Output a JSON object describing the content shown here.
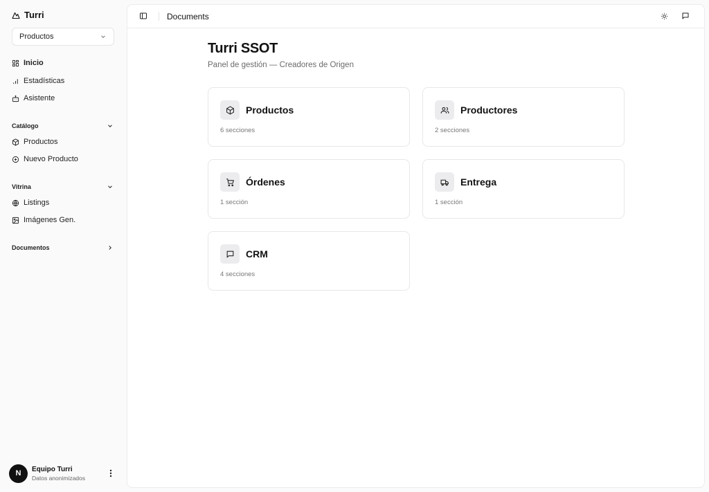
{
  "brand": {
    "name": "Turri"
  },
  "switcher": {
    "value": "Productos"
  },
  "nav": {
    "inicio": "Inicio",
    "estadisticas": "Estadísticas",
    "asistente": "Asistente"
  },
  "catalogo": {
    "label": "Catálogo",
    "productos": "Productos",
    "nuevo": "Nuevo Producto"
  },
  "vitrina": {
    "label": "Vitrina",
    "listings": "Listings",
    "imagenes": "Imágenes Gen."
  },
  "documentos": {
    "label": "Documentos"
  },
  "user": {
    "initial": "N",
    "name": "Equipo Turri",
    "sub": "Datos anonimizados"
  },
  "topbar": {
    "title": "Documents"
  },
  "page": {
    "title": "Turri SSOT",
    "subtitle": "Panel de gestión — Creadores de Origen"
  },
  "cards": [
    {
      "title": "Productos",
      "sub": "6 secciones",
      "icon": "package-icon"
    },
    {
      "title": "Productores",
      "sub": "2 secciones",
      "icon": "users-icon"
    },
    {
      "title": "Órdenes",
      "sub": "1 sección",
      "icon": "cart-icon"
    },
    {
      "title": "Entrega",
      "sub": "1 sección",
      "icon": "truck-icon"
    },
    {
      "title": "CRM",
      "sub": "4 secciones",
      "icon": "message-icon"
    }
  ]
}
